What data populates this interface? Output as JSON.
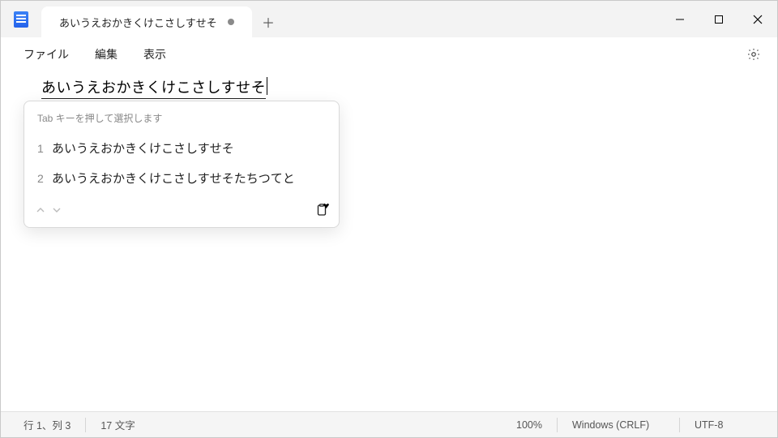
{
  "tab": {
    "title": "あいうえおかきくけこさしすせそ"
  },
  "menu": {
    "file": "ファイル",
    "edit": "編集",
    "view": "表示"
  },
  "editor": {
    "compose_text": "あいうえおかきくけこさしすせそ"
  },
  "ime": {
    "hint": "Tab キーを押して選択します",
    "candidates": [
      {
        "index": "1",
        "text": "あいうえおかきくけこさしすせそ"
      },
      {
        "index": "2",
        "text": "あいうえおかきくけこさしすせそたちつてと"
      }
    ]
  },
  "status": {
    "position": "行 1、列 3",
    "chars": "17 文字",
    "zoom": "100%",
    "eol": "Windows (CRLF)",
    "encoding": "UTF-8"
  }
}
